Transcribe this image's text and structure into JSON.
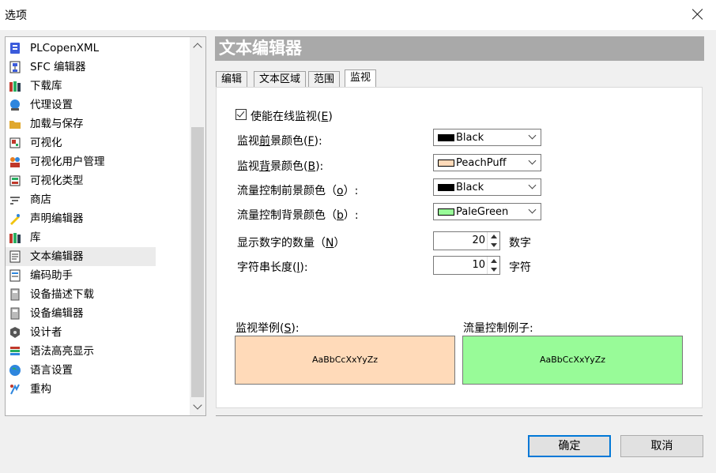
{
  "window": {
    "title": "选项"
  },
  "sidebar": {
    "items": [
      {
        "label": "PLCopenXML",
        "icon": "xml-icon"
      },
      {
        "label": "SFC 编辑器",
        "icon": "sfc-icon"
      },
      {
        "label": "下载库",
        "icon": "library-download-icon"
      },
      {
        "label": "代理设置",
        "icon": "proxy-icon"
      },
      {
        "label": "加载与保存",
        "icon": "folder-open-icon"
      },
      {
        "label": "可视化",
        "icon": "visualization-icon"
      },
      {
        "label": "可视化用户管理",
        "icon": "users-icon"
      },
      {
        "label": "可视化类型",
        "icon": "visualization-type-icon"
      },
      {
        "label": "商店",
        "icon": "store-icon"
      },
      {
        "label": "声明编辑器",
        "icon": "declaration-icon"
      },
      {
        "label": "库",
        "icon": "library-icon"
      },
      {
        "label": "文本编辑器",
        "icon": "text-editor-icon"
      },
      {
        "label": "编码助手",
        "icon": "coding-assistant-icon"
      },
      {
        "label": "设备描述下载",
        "icon": "device-download-icon"
      },
      {
        "label": "设备编辑器",
        "icon": "device-editor-icon"
      },
      {
        "label": "设计者",
        "icon": "designer-icon"
      },
      {
        "label": "语法高亮显示",
        "icon": "syntax-highlight-icon"
      },
      {
        "label": "语言设置",
        "icon": "globe-icon"
      },
      {
        "label": "重构",
        "icon": "refactor-icon"
      }
    ],
    "selected": "文本编辑器"
  },
  "main": {
    "title": "文本编辑器",
    "tabs": [
      {
        "label": "编辑"
      },
      {
        "label": "文本区域"
      },
      {
        "label": "范围"
      },
      {
        "label": "监视"
      }
    ],
    "active_tab": "监视",
    "online_monitor": {
      "label_pre": "使能在线监视(",
      "key": "E",
      "label_post": ")",
      "checked": true
    },
    "monitor_fg": {
      "label_pre": "监视",
      "key": "前",
      "label_mid": "景颜色(",
      "key2": "F",
      "label_post": "):",
      "value": "Black",
      "color": "#000000"
    },
    "monitor_bg": {
      "label_pre": "监视",
      "key": "背",
      "label_mid": "景颜色(",
      "key2": "B",
      "label_post": "):",
      "value": "PeachPuff",
      "color": "#ffdab9"
    },
    "flow_fg": {
      "label_pre": "流量控制前景颜色（",
      "key": "o",
      "label_post": "）:",
      "value": "Black",
      "color": "#000000"
    },
    "flow_bg": {
      "label_pre": "流量控制背景颜色（",
      "key": "b",
      "label_post": "）:",
      "value": "PaleGreen",
      "color": "#98fb98"
    },
    "num_digits": {
      "label_pre": "显示数字的数量（",
      "key": "N",
      "label_post": "）",
      "value": "20",
      "unit": "数字"
    },
    "string_length": {
      "label_pre": "字符串长度(",
      "key": "l",
      "label_post": "):",
      "value": "10",
      "unit": "字符"
    },
    "monitor_example": {
      "label_pre": "监视举例(",
      "key": "S",
      "label_post": "):",
      "text": "AaBbCcXxYyZz"
    },
    "flow_example": {
      "label": "流量控制例子:",
      "text": "AaBbCcXxYyZz"
    }
  },
  "buttons": {
    "ok": "确定",
    "cancel": "取消"
  }
}
